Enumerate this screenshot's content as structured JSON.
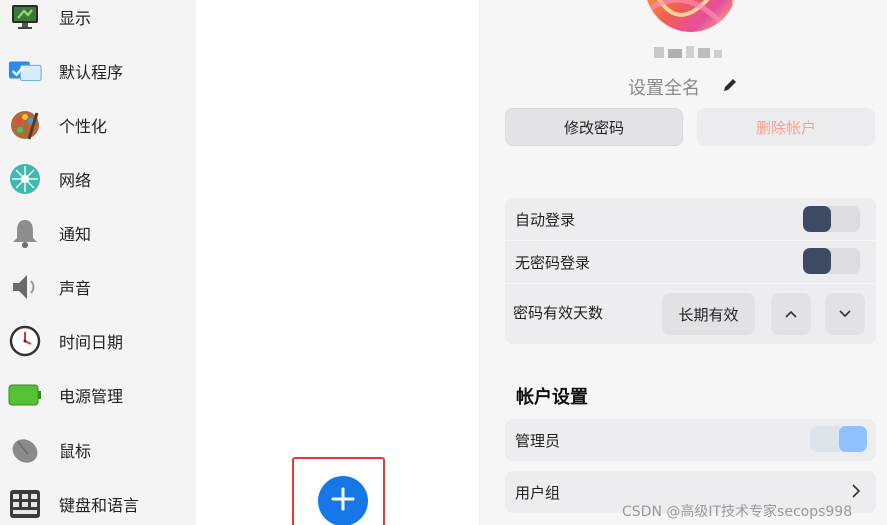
{
  "sidebar": {
    "items": [
      {
        "label": "显示",
        "icon": "monitor-icon"
      },
      {
        "label": "默认程序",
        "icon": "default-apps-icon"
      },
      {
        "label": "个性化",
        "icon": "palette-icon"
      },
      {
        "label": "网络",
        "icon": "network-icon"
      },
      {
        "label": "通知",
        "icon": "bell-icon"
      },
      {
        "label": "声音",
        "icon": "speaker-icon"
      },
      {
        "label": "时间日期",
        "icon": "clock-icon"
      },
      {
        "label": "电源管理",
        "icon": "battery-icon"
      },
      {
        "label": "鼠标",
        "icon": "mouse-icon"
      },
      {
        "label": "键盘和语言",
        "icon": "keyboard-icon"
      }
    ]
  },
  "account": {
    "set_fullname": "设置全名",
    "change_password": "修改密码",
    "delete_account": "删除帐户"
  },
  "login": {
    "auto_login": "自动登录",
    "auto_login_on": false,
    "passwordless_login": "无密码登录",
    "passwordless_login_on": false,
    "password_validity_label": "密码有效天数",
    "password_validity_value": "长期有效"
  },
  "account_settings": {
    "title": "帐户设置",
    "admin_label": "管理员",
    "admin_on": true,
    "user_group_label": "用户组"
  },
  "watermark": "CSDN @高级IT技术专家secops998",
  "colors": {
    "accent": "#1677e8",
    "toggle_off_knob": "#3d4a63",
    "toggle_on_knob": "#8fc1ff",
    "delete_text": "#f4a28f",
    "highlight_border": "#e53935"
  }
}
